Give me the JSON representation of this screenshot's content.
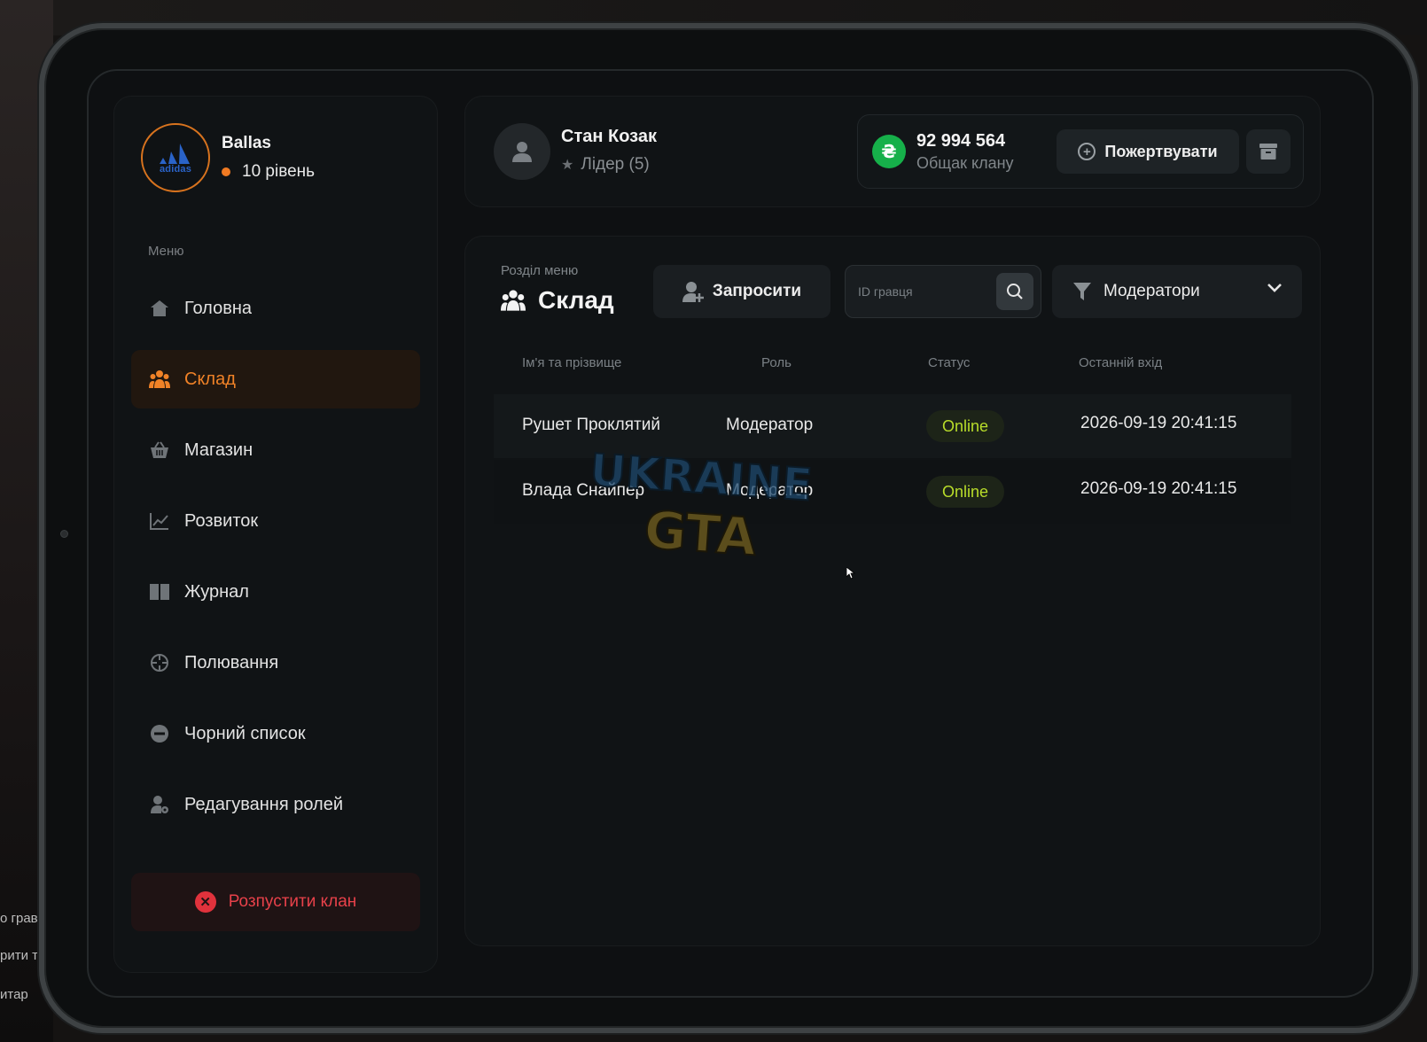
{
  "background": {
    "left_lines": [
      "о грав",
      "рити т",
      "итар"
    ]
  },
  "clan": {
    "logo_text": "adidas",
    "name": "Ballas",
    "level": "10 рівень"
  },
  "sidebar": {
    "menu_caption": "Меню",
    "items": [
      {
        "label": "Головна",
        "icon": "home-icon"
      },
      {
        "label": "Склад",
        "icon": "members-icon",
        "active": true
      },
      {
        "label": "Магазин",
        "icon": "basket-icon"
      },
      {
        "label": "Розвиток",
        "icon": "chart-icon"
      },
      {
        "label": "Журнал",
        "icon": "book-icon"
      },
      {
        "label": "Полювання",
        "icon": "crosshair-icon"
      },
      {
        "label": "Чорний список",
        "icon": "minus-circle-icon"
      },
      {
        "label": "Редагування ролей",
        "icon": "user-gear-icon"
      }
    ],
    "disband_label": "Розпустити клан"
  },
  "header": {
    "user_name": "Стан Козак",
    "user_role": "Лідер (5)",
    "money_amount": "92 994 564",
    "money_label": "Общак клану",
    "currency_symbol": "₴",
    "donate_label": "Пожертвувати"
  },
  "main": {
    "section_caption": "Розділ меню",
    "section_title": "Склад",
    "invite_label": "Запросити",
    "search_placeholder": "ID гравця",
    "filter_value": "Модератори",
    "columns": [
      "Ім'я та прізвище",
      "Роль",
      "Статус",
      "Останній вхід"
    ],
    "rows": [
      {
        "name": "Рушет Проклятий",
        "role": "Модератор",
        "status": "Online",
        "last_login": "2026-09-19 20:41:15"
      },
      {
        "name": "Влада Снайпер",
        "role": "Модератор",
        "status": "Online",
        "last_login": "2026-09-19 20:41:15"
      }
    ]
  },
  "watermark": {
    "line1": "UKRAINE",
    "line2": "GTA"
  },
  "colors": {
    "accent": "#f08227",
    "status_online": "#b8dc2a",
    "danger": "#e8414a",
    "money_green": "#16b04a"
  }
}
